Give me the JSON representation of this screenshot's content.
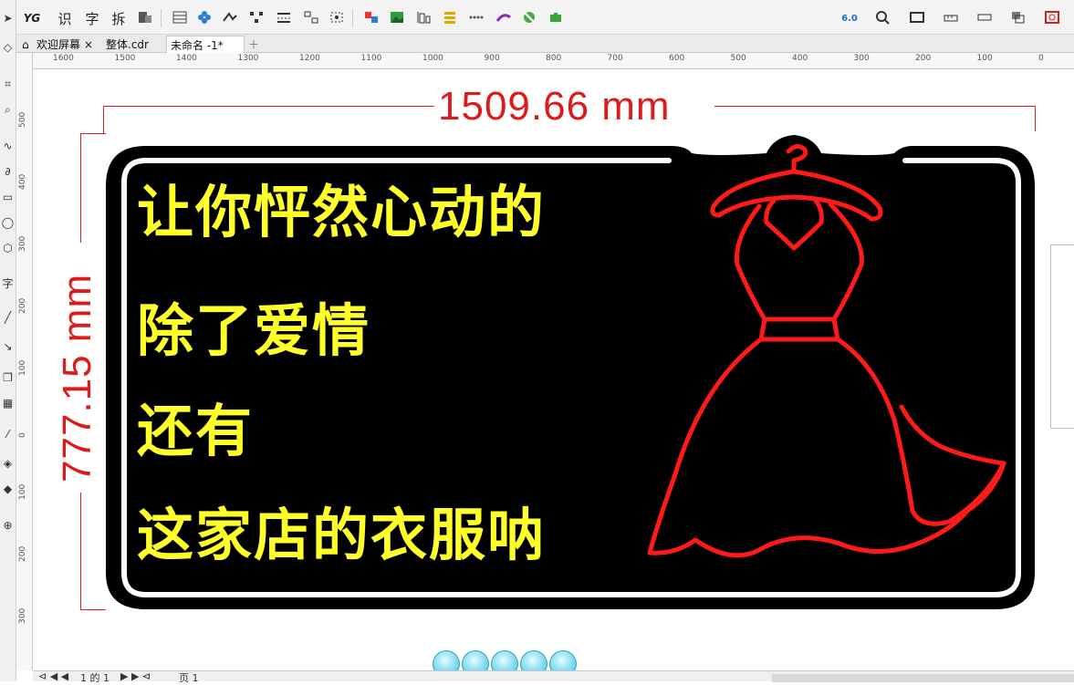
{
  "tabs": [
    {
      "label": "欢迎屏幕",
      "close": "×"
    },
    {
      "label": "整体.cdr"
    },
    {
      "label": "未命名 -1*"
    }
  ],
  "toolbar": {
    "yg": "YG",
    "btn_recognize": "识",
    "btn_char": "字",
    "btn_split": "拆",
    "cut_version": "6.0"
  },
  "toolbox": {
    "text_tool": "字"
  },
  "ruler": {
    "h_labels": [
      "1600",
      "1500",
      "1400",
      "1300",
      "1200",
      "1100",
      "1000",
      "900",
      "800",
      "700",
      "600",
      "500",
      "400",
      "300",
      "200",
      "100",
      "0"
    ],
    "v_labels": [
      "500",
      "400",
      "300",
      "200",
      "100",
      "0",
      "100",
      "200",
      "300"
    ]
  },
  "dimensions": {
    "width": "1509.66 mm",
    "height": "777.15 mm"
  },
  "sign": {
    "lines": [
      "让你怦然心动的",
      "除了爱情",
      "还有",
      "这家店的衣服呐"
    ],
    "text_color": "#ffff2a",
    "dress_color": "#ff1a1a",
    "board_color": "#000000"
  },
  "status": {
    "page_info": "1 的 1",
    "page_tab": "页 1"
  }
}
